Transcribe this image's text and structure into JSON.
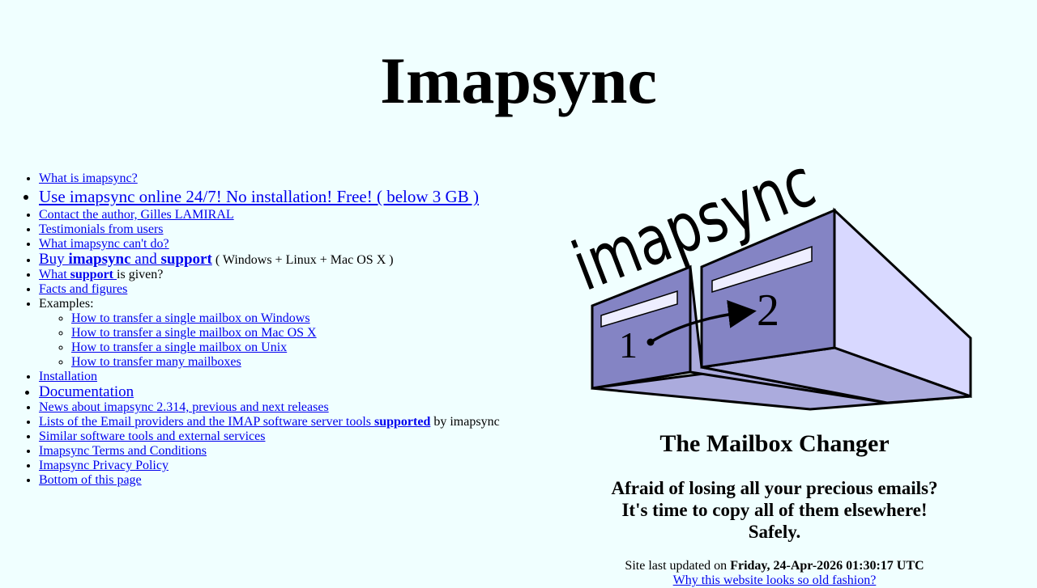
{
  "page": {
    "title": "Imapsync"
  },
  "nav": {
    "what_is": "What is imapsync?",
    "online": "Use imapsync online 24/7! No installation! Free! ( below 3 GB )",
    "contact": "Contact the author, Gilles LAMIRAL",
    "testimonials": "Testimonials from users",
    "cant_do": "What imapsync can't do?",
    "buy_prefix": "Buy ",
    "buy_imapsync": "imapsync",
    "buy_and": " and ",
    "buy_support": "support",
    "buy_platforms": " ( Windows + Linux + Mac OS X )",
    "what_prefix": "What ",
    "what_support": "support ",
    "what_suffix": "is given?",
    "facts": "Facts and figures",
    "examples_label": "Examples:",
    "examples": {
      "windows": "How to transfer a single mailbox on Windows",
      "macosx": "How to transfer a single mailbox on Mac OS X",
      "unix": "How to transfer a single mailbox on Unix",
      "many": "How to transfer many mailboxes"
    },
    "installation": "Installation",
    "documentation": "Documentation",
    "news": "News about imapsync 2.314, previous and next releases",
    "lists_prefix": "Lists of the Email providers and the IMAP software server tools ",
    "lists_supported": "supported",
    "lists_suffix": " by imapsync",
    "similar": "Similar software tools and external services",
    "terms": "Imapsync Terms and Conditions",
    "privacy": "Imapsync Privacy Policy",
    "bottom": "Bottom of this page"
  },
  "logo": {
    "word": "imapsync",
    "box1": "1",
    "box2": "2",
    "colors": {
      "front": "#8484c4",
      "side": "#d8d8ff",
      "bottom": "#ababdd"
    }
  },
  "tagline": "The Mailbox Changer",
  "pitch": {
    "line1": "Afraid of losing all your precious emails?",
    "line2": "It's time to copy all of them elsewhere!",
    "line3": "Safely."
  },
  "footer": {
    "updated_prefix": "Site last updated on ",
    "updated_date": "Friday, 24-Apr-2026 01:30:17 UTC",
    "old_fashion": "Why this website looks so old fashion?"
  }
}
